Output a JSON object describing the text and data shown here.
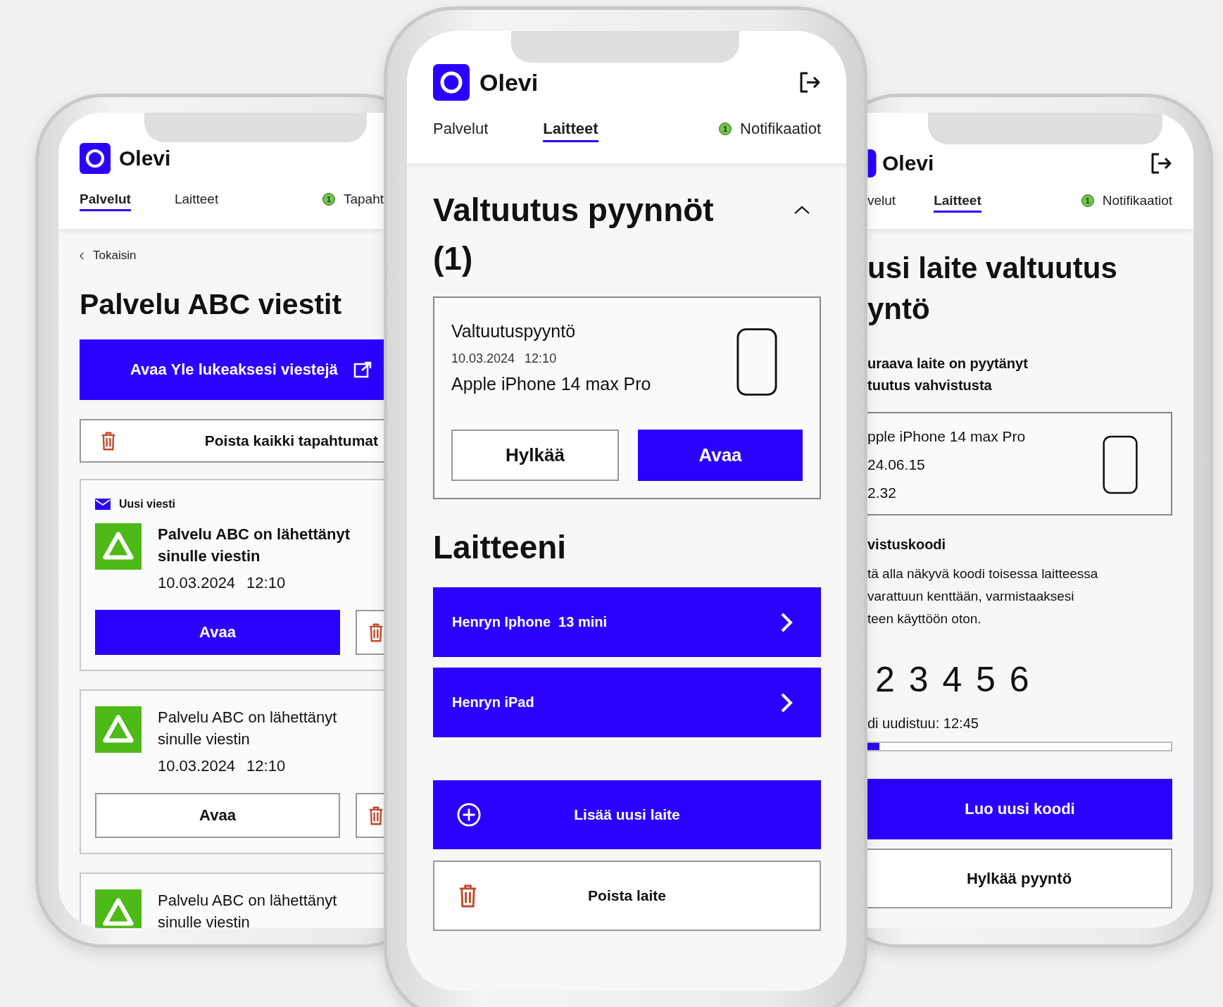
{
  "left_phone": {
    "header": {
      "app_name": "Olevi",
      "tabs": [
        {
          "label": "Palvelut",
          "selected": true
        },
        {
          "label": "Laitteet",
          "selected": false
        },
        {
          "label": "Tapaht",
          "selected": false,
          "badge": "1"
        }
      ]
    },
    "back_link": "Tokaisin",
    "title": "Palvelu ABC viestit",
    "open_button": "Avaa Yle lukeaksesi viestejä",
    "delete_all_button": "Poista kaikki tapahtumat",
    "messages": [
      {
        "unread": true,
        "tag": "Uusi viesti",
        "text": "Palvelu ABC on lähettänyt sinulle viestin",
        "date": "10.03.2024",
        "time": "12:10",
        "button": "Avaa"
      },
      {
        "unread": false,
        "text": "Palvelu ABC on lähettänyt sinulle viestin",
        "date": "10.03.2024",
        "time": "12:10",
        "button": "Avaa"
      },
      {
        "unread": false,
        "text": "Palvelu ABC on lähettänyt sinulle viestin"
      }
    ]
  },
  "center_phone": {
    "header": {
      "app_name": "Olevi",
      "has_logout": true,
      "tabs": [
        {
          "label": "Palvelut",
          "selected": false
        },
        {
          "label": "Laitteet",
          "selected": true
        },
        {
          "label": "Notifikaatiot",
          "selected": false,
          "badge": "1"
        }
      ]
    },
    "requests": {
      "title": "Valtuutus pyynnöt (1)",
      "expanded": true,
      "items": [
        {
          "label": "Valtuutuspyyntö",
          "date": "10.03.2024",
          "time": "12:10",
          "device": "Apple iPhone 14 max Pro",
          "reject_button": "Hylkää",
          "open_button": "Avaa"
        }
      ]
    },
    "devices_title": "Laitteeni",
    "devices": [
      "Henryn Iphone  13 mini",
      "Henryn iPad"
    ],
    "add_button": "Lisää uusi laite",
    "delete_button": "Poista laite"
  },
  "right_phone": {
    "header": {
      "app_name": "Olevi",
      "has_logout": true,
      "tabs": [
        {
          "label": "velut",
          "selected": false
        },
        {
          "label": "Laitteet",
          "selected": true
        },
        {
          "label": "Notifikaatiot",
          "selected": false,
          "badge": "1"
        }
      ]
    },
    "title_lines": [
      "usi laite valtuutus",
      "yntö"
    ],
    "intro_lines": [
      "uraava laite on pyytänyt",
      "tuutus vahvistusta"
    ],
    "device_lines": [
      "pple iPhone 14 max Pro",
      "24.06.15",
      "2.32"
    ],
    "code_title": "vistuskoodi",
    "code_text_lines": [
      "tä alla näkyvä koodi toisessa laitteessa",
      "varattuun kenttään, varmistaaksesi",
      "teen käyttöön oton."
    ],
    "code": "2 3 4 5 6",
    "renew_text": "di uudistuu: 12:45",
    "timer": {
      "level": 0.04
    },
    "new_code_button": "Luo uusi koodi",
    "reject_button": "Hylkää pyyntö"
  }
}
